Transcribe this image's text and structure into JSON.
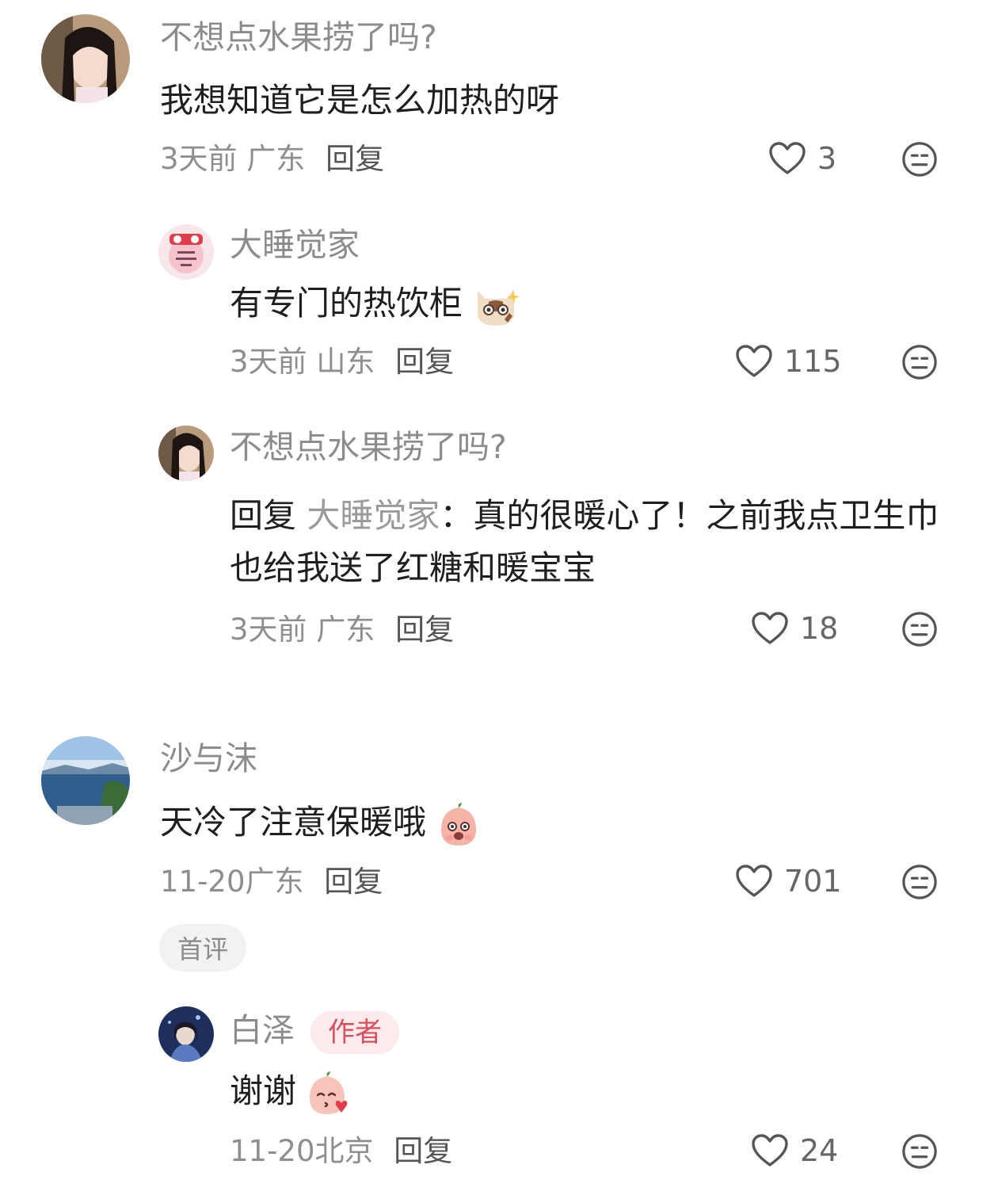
{
  "comments": [
    {
      "username": "不想点水果捞了吗?",
      "text": "我想知道它是怎么加热的呀",
      "time": "3天前",
      "location": "广东",
      "reply_label": "回复",
      "likes": "3"
    },
    {
      "username": "大睡觉家",
      "text": "有专门的热饮柜",
      "time": "3天前",
      "location": "山东",
      "reply_label": "回复",
      "likes": "115"
    },
    {
      "username": "不想点水果捞了吗?",
      "reply_prefix": "回复",
      "reply_target": "大睡觉家",
      "reply_colon": "：",
      "text": "真的很暖心了！之前我点卫生巾也给我送了红糖和暖宝宝",
      "time": "3天前",
      "location": "广东",
      "reply_label": "回复",
      "likes": "18"
    },
    {
      "username": "沙与沫",
      "text": "天冷了注意保暖哦",
      "time": "11-20",
      "location": "广东",
      "reply_label": "回复",
      "likes": "701",
      "badge": "首评"
    },
    {
      "username": "白泽",
      "author_badge": "作者",
      "text": "谢谢",
      "time": "11-20",
      "location": "北京",
      "reply_label": "回复",
      "likes": "24"
    }
  ],
  "colors": {
    "username": "#8c8c8c",
    "text": "#1f1f1f",
    "author_badge_text": "#d94f5c",
    "author_badge_bg": "#fdeaec"
  },
  "icons": [
    "heart-outline-icon",
    "unamused-face-icon",
    "cat-emoji-icon",
    "peach-surprised-emoji-icon",
    "peach-kiss-emoji-icon"
  ]
}
